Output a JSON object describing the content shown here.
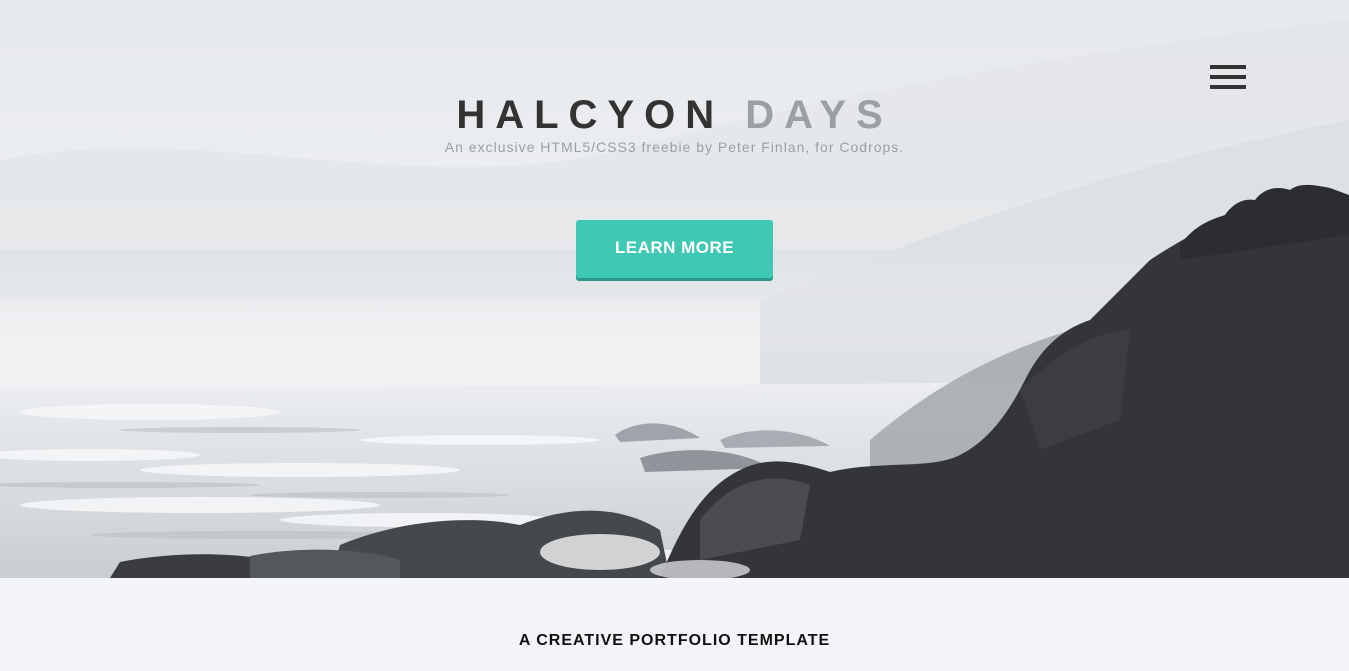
{
  "hero": {
    "title_dark": "HALCYON",
    "title_light": "DAYS",
    "subtitle": "An exclusive HTML5/CSS3 freebie by Peter Finlan, for Codrops.",
    "cta_label": "LEARN MORE",
    "menu_icon": "hamburger-menu-icon",
    "background_image": "misty rocky coastline with waves"
  },
  "section": {
    "title": "A CREATIVE PORTFOLIO TEMPLATE"
  },
  "colors": {
    "accent": "#3fc8b3",
    "title_dark": "#333333",
    "title_light": "#9aa0a6",
    "section_bg": "#f3f5f8"
  }
}
